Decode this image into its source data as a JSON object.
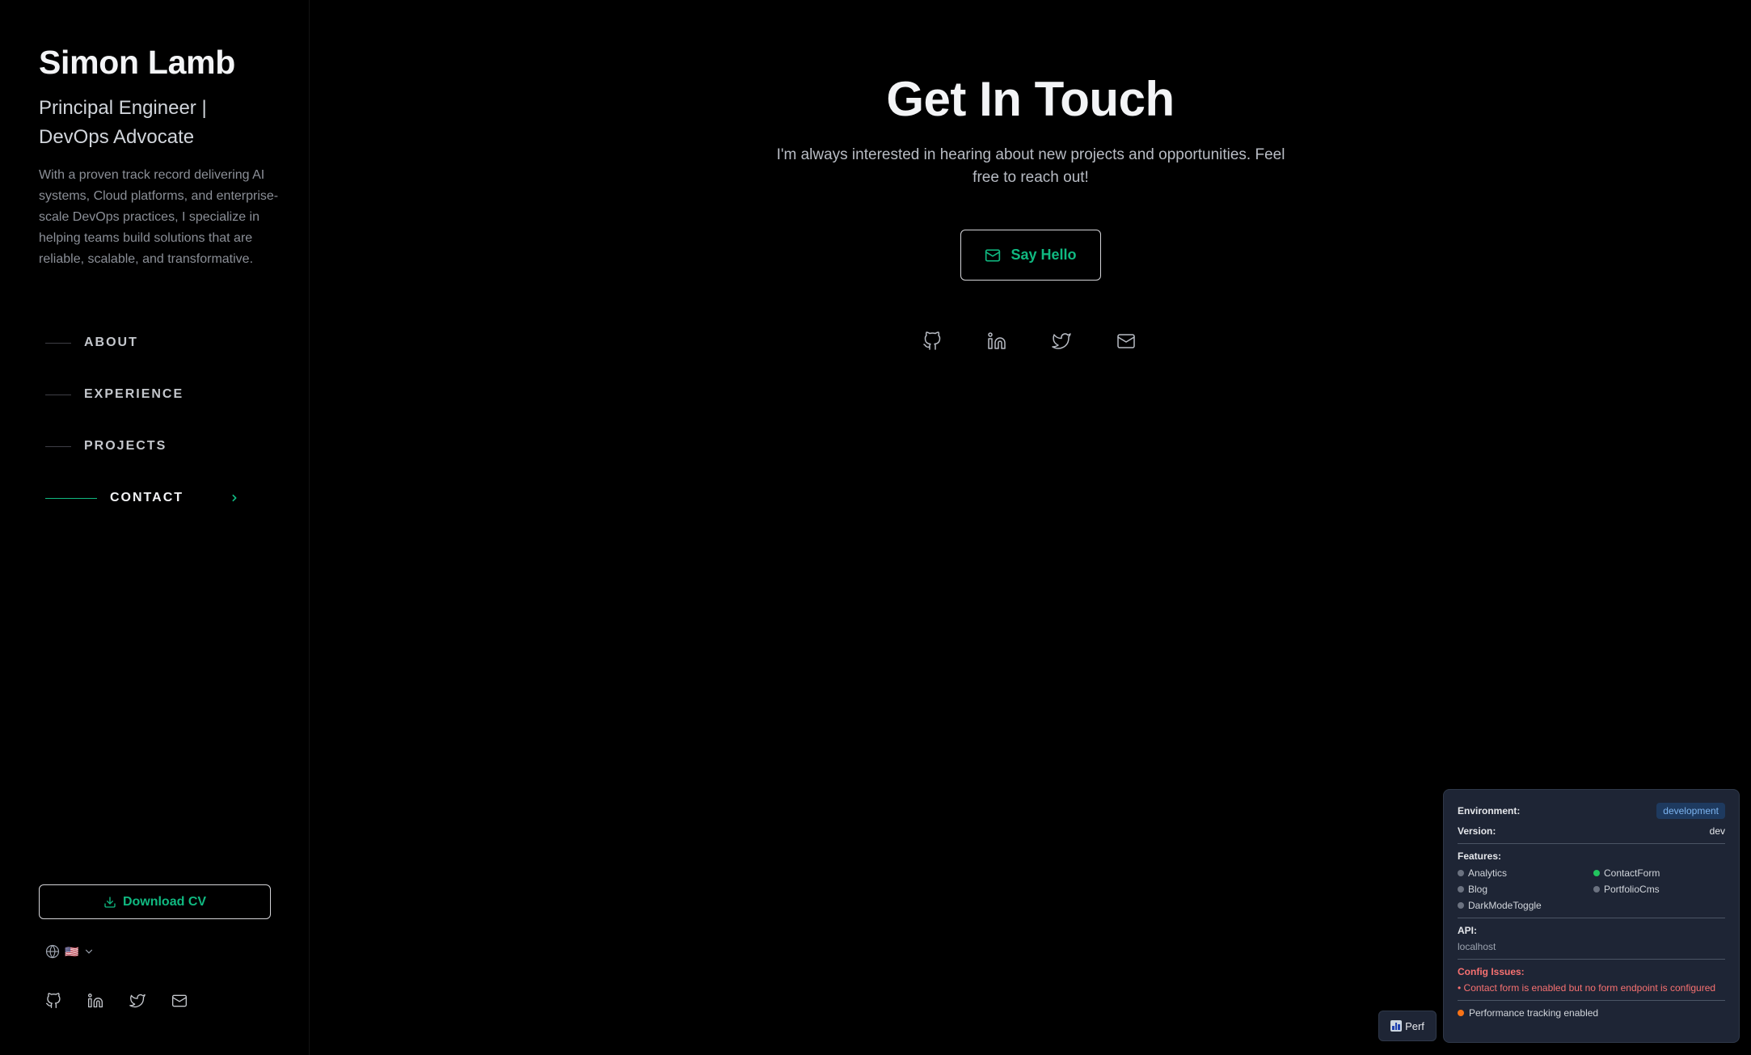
{
  "sidebar": {
    "name": "Simon Lamb",
    "role": "Principal Engineer | DevOps Advocate",
    "bio": "With a proven track record delivering AI systems, Cloud platforms, and enterprise-scale DevOps practices, I specialize in helping teams build solutions that are reliable, scalable, and transformative.",
    "nav": [
      {
        "label": "ABOUT",
        "active": false
      },
      {
        "label": "EXPERIENCE",
        "active": false
      },
      {
        "label": "PROJECTS",
        "active": false
      },
      {
        "label": "CONTACT",
        "active": true
      }
    ],
    "download_cv_label": "Download CV",
    "language_flag": "🇺🇸",
    "social_icons": [
      "github-icon",
      "linkedin-icon",
      "twitter-icon",
      "mail-icon"
    ]
  },
  "main": {
    "title": "Get In Touch",
    "description": "I'm always interested in hearing about new projects and opportunities. Feel free to reach out!",
    "say_hello_label": "Say Hello",
    "social_icons": [
      "github-icon",
      "linkedin-icon",
      "twitter-icon",
      "mail-icon"
    ]
  },
  "debug_panel": {
    "environment_label": "Environment:",
    "environment_value": "development",
    "version_label": "Version:",
    "version_value": "dev",
    "features_label": "Features:",
    "features": [
      {
        "name": "Analytics",
        "enabled": false
      },
      {
        "name": "ContactForm",
        "enabled": true
      },
      {
        "name": "Blog",
        "enabled": false
      },
      {
        "name": "PortfolioCms",
        "enabled": false
      },
      {
        "name": "DarkModeToggle",
        "enabled": false
      }
    ],
    "api_label": "API:",
    "api_value": "localhost",
    "config_issues_label": "Config Issues:",
    "config_issue": "• Contact form is enabled but no form endpoint is configured",
    "performance_text": "Performance tracking enabled"
  },
  "perf_button_label": "Perf",
  "colors": {
    "accent": "#10b981",
    "background": "#000000",
    "panel": "#1e2535",
    "error": "#f87171",
    "warning": "#f97316"
  }
}
